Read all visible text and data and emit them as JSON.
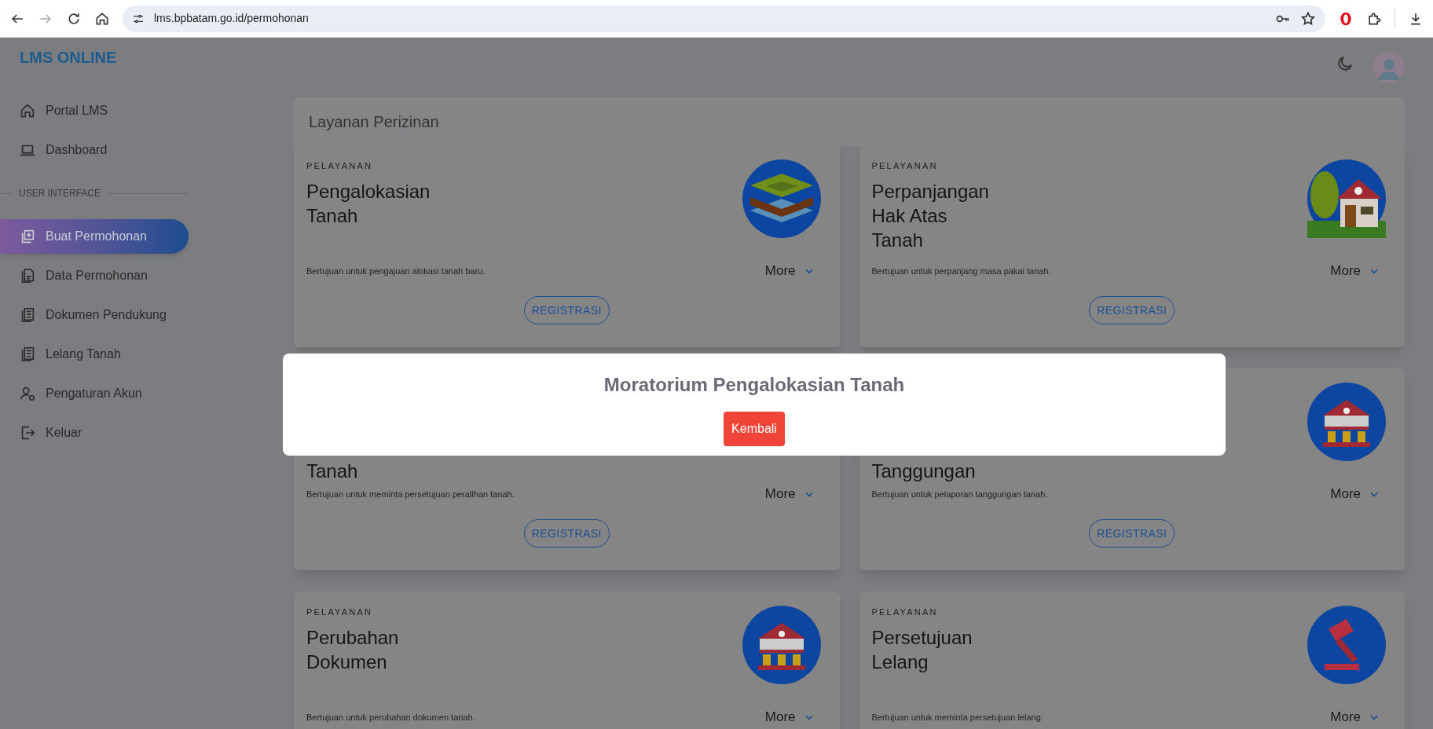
{
  "browser": {
    "url": "lms.bpbatam.go.id/permohonan"
  },
  "sidebar": {
    "logo": "LMS ONLINE",
    "items": [
      {
        "kind": "link",
        "label": "Portal LMS",
        "selected": false
      },
      {
        "kind": "link",
        "label": "Dashboard",
        "selected": false
      },
      {
        "kind": "heading",
        "label": "USER INTERFACE"
      },
      {
        "kind": "link",
        "label": "Buat Permohonan",
        "selected": true
      },
      {
        "kind": "link",
        "label": "Data Permohonan",
        "selected": false
      },
      {
        "kind": "link",
        "label": "Dokumen Pendukung",
        "selected": false
      },
      {
        "kind": "link",
        "label": "Lelang Tanah",
        "selected": false
      },
      {
        "kind": "link",
        "label": "Pengaturan Akun",
        "selected": false
      },
      {
        "kind": "link",
        "label": "Keluar",
        "selected": false
      }
    ]
  },
  "panel_title": "Layanan Perizinan",
  "cards": [
    {
      "eyebrow": "PELAYANAN",
      "title_lines": [
        "Pengalokasian",
        "Tanah"
      ],
      "description": "Bertujuan untuk pengajuan alokasi tanah baru.",
      "more": "More",
      "button": "REGISTRASI"
    },
    {
      "eyebrow": "PELAYANAN",
      "title_lines": [
        "Perpanjangan",
        "Hak Atas",
        "Tanah"
      ],
      "description": "Bertujuan untuk perpanjang masa pakai tanah.",
      "more": "More",
      "button": "REGISTRASI"
    },
    {
      "title_lines": [
        "Tanah"
      ],
      "description": "Bertujuan untuk meminta persetujuan peralihan tanah.",
      "more": "More",
      "button": "REGISTRASI"
    },
    {
      "title_lines": [
        "Tanggungan"
      ],
      "description": "Bertujuan untuk pelaporan tanggungan tanah.",
      "more": "More",
      "button": "REGISTRASI"
    },
    {
      "eyebrow": "PELAYANAN",
      "title_lines": [
        "Perubahan",
        "Dokumen"
      ],
      "description": "Bertujuan untuk perubahan dokumen tanah.",
      "more": "More"
    },
    {
      "eyebrow": "PELAYANAN",
      "title_lines": [
        "Persetujuan",
        "Lelang"
      ],
      "description": "Bertujuan untuk meminta persetujuan lelang.",
      "more": "More"
    }
  ],
  "modal": {
    "title": "Moratorium Pengalokasian Tanah",
    "button": "Kembali"
  }
}
